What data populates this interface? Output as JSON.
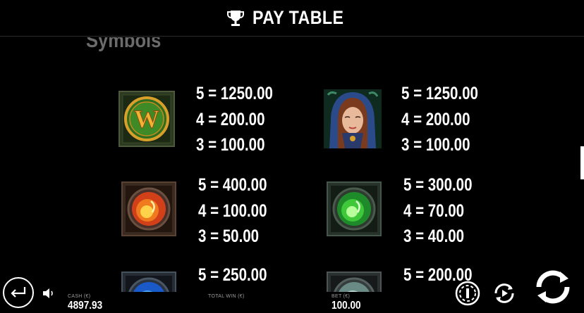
{
  "header": {
    "title": "PAY TABLE",
    "icon": "trophy-icon"
  },
  "section": {
    "title": "Symbols"
  },
  "symbols": [
    {
      "icon": "wild-w-symbol-icon",
      "payouts": [
        "5 = 1250.00",
        "4 = 200.00",
        "3 = 100.00"
      ]
    },
    {
      "icon": "hooded-woman-symbol-icon",
      "payouts": [
        "5 = 1250.00",
        "4 = 200.00",
        "3 = 100.00"
      ]
    },
    {
      "icon": "fire-orb-symbol-icon",
      "payouts": [
        "5 = 400.00",
        "4 = 100.00",
        "3 = 50.00"
      ]
    },
    {
      "icon": "green-orb-symbol-icon",
      "payouts": [
        "5 = 300.00",
        "4 = 70.00",
        "3 = 40.00"
      ]
    },
    {
      "icon": "blue-orb-symbol-icon",
      "payouts": [
        "5 = 250.00"
      ]
    },
    {
      "icon": "silver-orb-symbol-icon",
      "payouts": [
        "5 = 200.00"
      ]
    }
  ],
  "footer": {
    "cash_label": "CASH (€)",
    "cash_value": "4897.93",
    "total_win_label": "TOTAL WIN (€)",
    "bet_label": "BET (€)",
    "bet_value": "100.00"
  },
  "colors": {
    "background": "#000000",
    "text": "#ffffff",
    "section_title": "#6b6b6b"
  }
}
